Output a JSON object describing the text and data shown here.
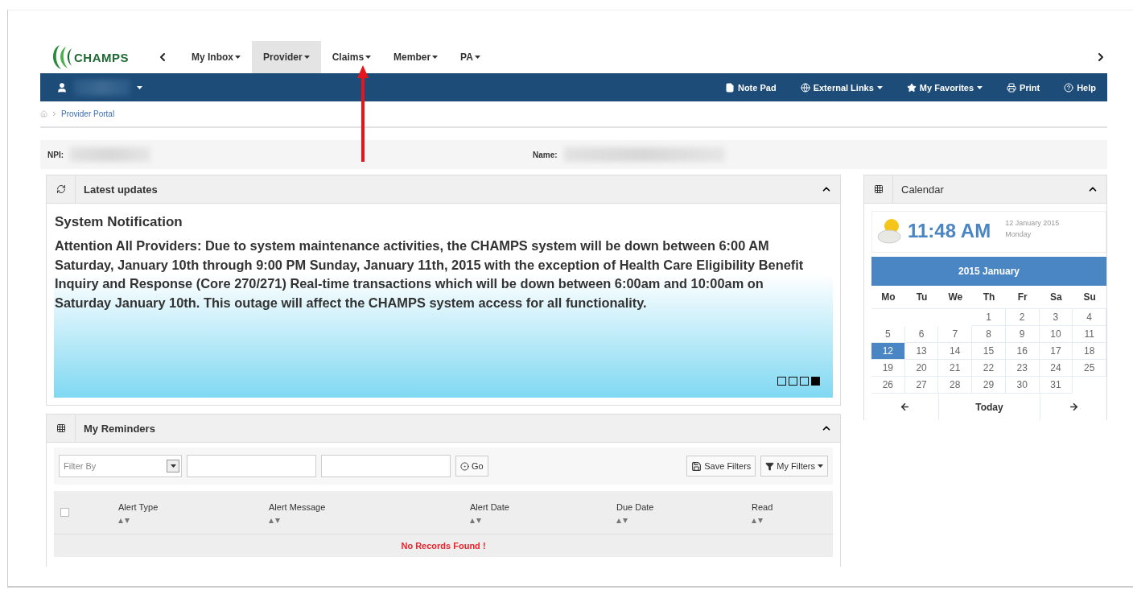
{
  "logo": {
    "text": "CHAMPS"
  },
  "nav": {
    "menu": [
      {
        "label": "My Inbox",
        "selected": false
      },
      {
        "label": "Provider",
        "selected": true
      },
      {
        "label": "Claims",
        "selected": false
      },
      {
        "label": "Member",
        "selected": false
      },
      {
        "label": "PA",
        "selected": false
      }
    ]
  },
  "toolbar": {
    "links": [
      {
        "label": "Note Pad",
        "kind": "notepad"
      },
      {
        "label": "External Links",
        "kind": "globe"
      },
      {
        "label": "My Favorites",
        "kind": "star"
      },
      {
        "label": "Print",
        "kind": "print"
      },
      {
        "label": "Help",
        "kind": "help"
      }
    ]
  },
  "breadcrumb": {
    "items": [
      "Provider Portal"
    ]
  },
  "info": {
    "npi_label": "NPI:",
    "name_label": "Name:"
  },
  "updates": {
    "title": "Latest updates",
    "heading": "System Notification",
    "text": "Attention All Providers: Due to system maintenance activities, the CHAMPS system will be down between 6:00 AM Saturday, January 10th through 9:00 PM Sunday, January 11th, 2015 with the exception of Health Care Eligibility Benefit Inquiry and Response (Core 270/271) Real-time transactions which will be down between 6:00am and 10:00am on Saturday January 10th. This outage will affect the CHAMPS system access for all functionality.",
    "pages": [
      {
        "selected": false
      },
      {
        "selected": false
      },
      {
        "selected": false
      },
      {
        "selected": true
      }
    ]
  },
  "reminders": {
    "title": "My Reminders",
    "filter_placeholder": "Filter By",
    "go": "Go",
    "save_filters": "Save Filters",
    "my_filters": "My Filters",
    "select_all": {
      "checked": false
    },
    "columns": [
      "Alert Type",
      "Alert Message",
      "Alert Date",
      "Due Date",
      "Read"
    ],
    "empty": "No Records Found !"
  },
  "calendar": {
    "title": "Calendar",
    "time": "11:48 AM",
    "date": "12 January 2015",
    "weekday": "Monday",
    "month": "2015 January",
    "today": "Today",
    "weekdays": [
      "Mo",
      "Tu",
      "We",
      "Th",
      "Fr",
      "Sa",
      "Su"
    ],
    "weeks": [
      {
        "days": [
          {
            "kind": "blank"
          },
          {
            "kind": "blank"
          },
          {
            "kind": "blank"
          },
          {
            "day": "1",
            "selected": false
          },
          {
            "day": "2",
            "selected": false
          },
          {
            "day": "3",
            "selected": false
          },
          {
            "day": "4",
            "selected": false
          }
        ]
      },
      {
        "days": [
          {
            "day": "5",
            "selected": false
          },
          {
            "day": "6",
            "selected": false
          },
          {
            "day": "7",
            "selected": false
          },
          {
            "day": "8",
            "selected": false
          },
          {
            "day": "9",
            "selected": false
          },
          {
            "day": "10",
            "selected": false
          },
          {
            "day": "11",
            "selected": false
          }
        ]
      },
      {
        "days": [
          {
            "day": "12",
            "selected": true
          },
          {
            "day": "13",
            "selected": false
          },
          {
            "day": "14",
            "selected": false
          },
          {
            "day": "15",
            "selected": false
          },
          {
            "day": "16",
            "selected": false
          },
          {
            "day": "17",
            "selected": false
          },
          {
            "day": "18",
            "selected": false
          }
        ]
      },
      {
        "days": [
          {
            "day": "19",
            "selected": false
          },
          {
            "day": "20",
            "selected": false
          },
          {
            "day": "21",
            "selected": false
          },
          {
            "day": "22",
            "selected": false
          },
          {
            "day": "23",
            "selected": false
          },
          {
            "day": "24",
            "selected": false
          },
          {
            "day": "25",
            "selected": false
          }
        ]
      },
      {
        "days": [
          {
            "day": "26",
            "selected": false
          },
          {
            "day": "27",
            "selected": false
          },
          {
            "day": "28",
            "selected": false
          },
          {
            "day": "29",
            "selected": false
          },
          {
            "day": "30",
            "selected": false
          },
          {
            "day": "31",
            "selected": false
          },
          {
            "kind": "blank"
          }
        ]
      }
    ]
  }
}
